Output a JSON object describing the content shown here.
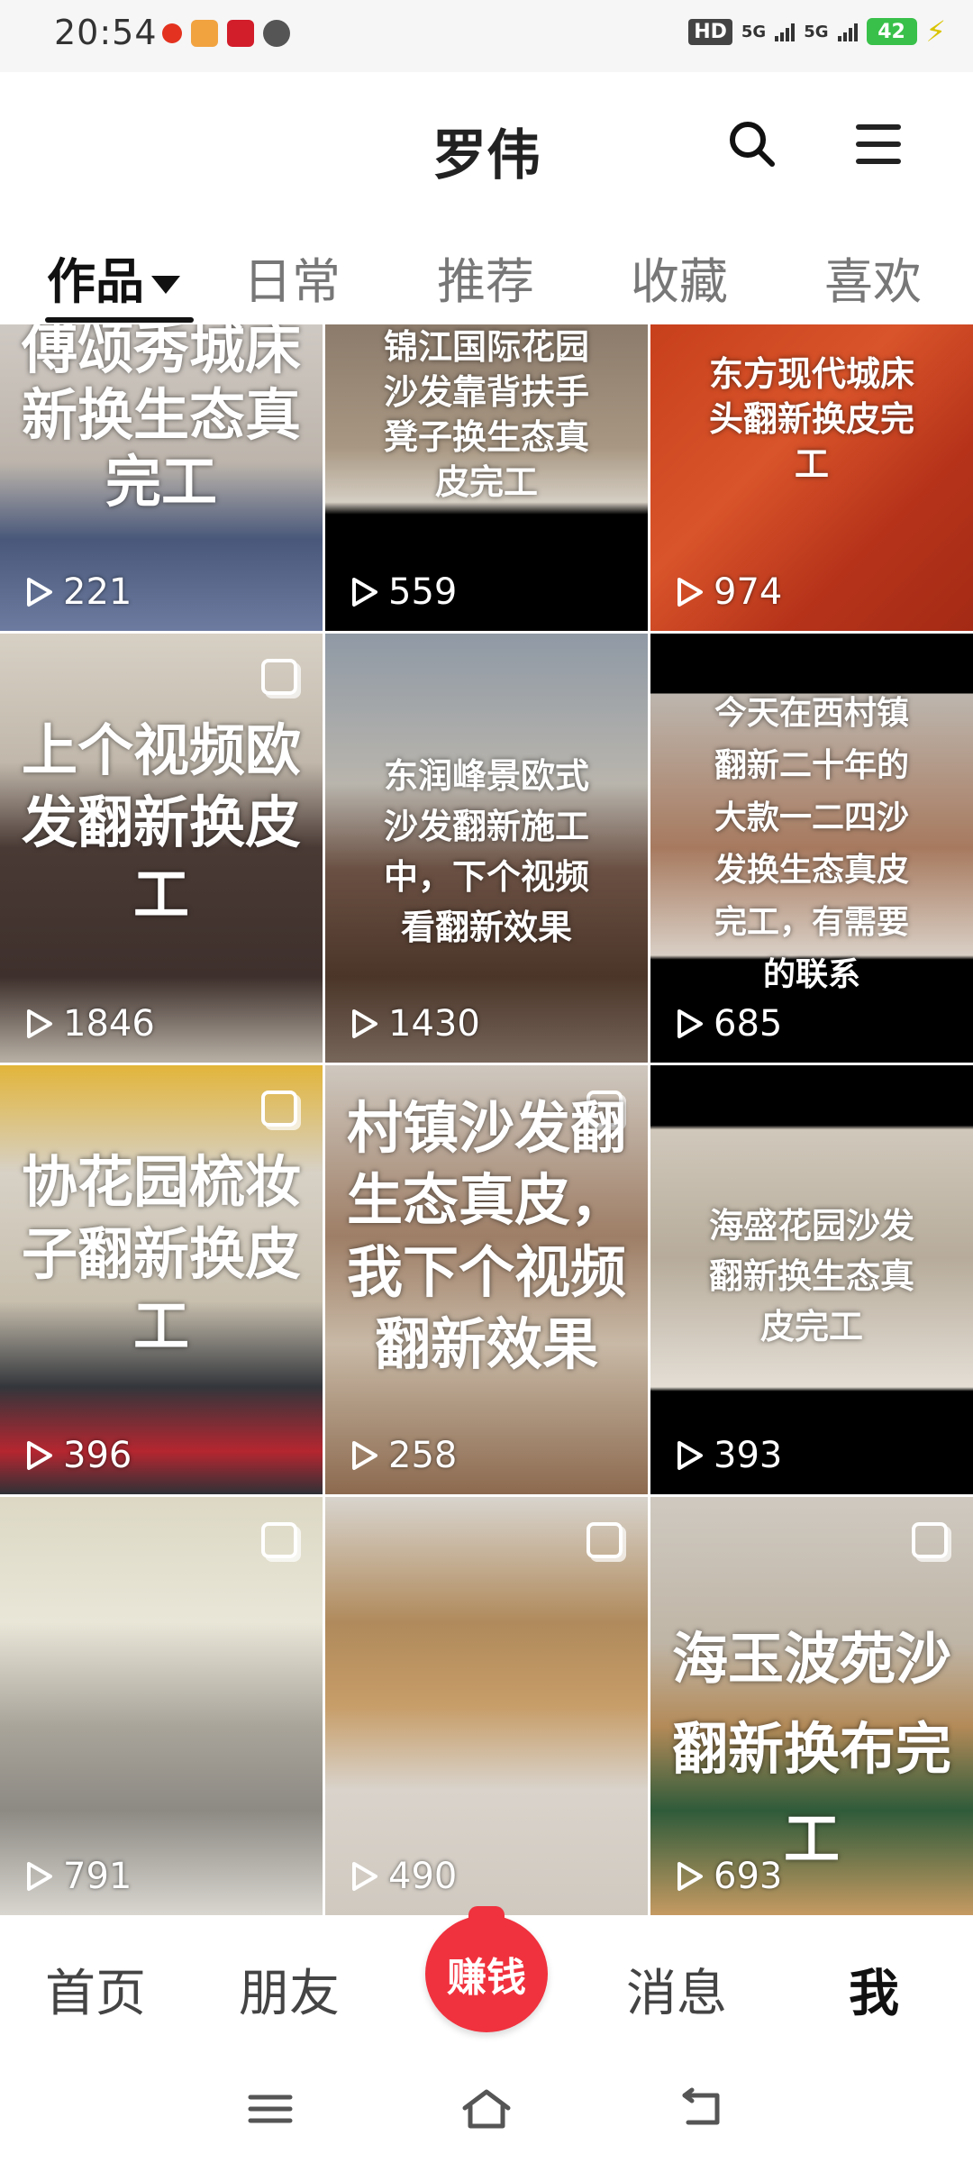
{
  "status_bar": {
    "time": "20:54",
    "network_labels": [
      "HD",
      "5G",
      "5G"
    ],
    "battery": "42"
  },
  "header": {
    "title": "罗伟"
  },
  "tabs": [
    {
      "label": "作品",
      "active": true
    },
    {
      "label": "日常"
    },
    {
      "label": "推荐"
    },
    {
      "label": "收藏"
    },
    {
      "label": "喜欢"
    }
  ],
  "videos": [
    {
      "overlay_lines": [
        "傅颂秀城床",
        "新换生态真",
        "完工"
      ],
      "plays": "221"
    },
    {
      "overlay_lines": [
        "锦江国际花园",
        "沙发靠背扶手",
        "凳子换生态真",
        "皮完工"
      ],
      "plays": "559"
    },
    {
      "overlay_lines": [
        "东方现代城床",
        "头翻新换皮完",
        "工"
      ],
      "plays": "974"
    },
    {
      "overlay_lines": [
        "上个视频欧",
        "发翻新换皮",
        "工"
      ],
      "plays": "1846"
    },
    {
      "overlay_lines": [
        "东润峰景欧式",
        "沙发翻新施工",
        "中，下个视频",
        "看翻新效果"
      ],
      "plays": "1430"
    },
    {
      "overlay_lines": [
        "今天在西村镇",
        "翻新二十年的",
        "大款一二四沙",
        "发换生态真皮",
        "完工，有需要",
        "的联系"
      ],
      "plays": "685"
    },
    {
      "overlay_lines": [
        "协花园梳妆",
        "子翻新换皮",
        "工"
      ],
      "plays": "396"
    },
    {
      "overlay_lines": [
        "村镇沙发翻",
        "生态真皮，",
        "我下个视频",
        "翻新效果"
      ],
      "plays": "258"
    },
    {
      "overlay_lines": [
        "海盛花园沙发",
        "翻新换生态真",
        "皮完工"
      ],
      "plays": "393"
    },
    {
      "overlay_lines": [],
      "plays": "791"
    },
    {
      "overlay_lines": [],
      "plays": "490"
    },
    {
      "overlay_lines": [
        "海玉波苑沙",
        "翻新换布完工"
      ],
      "plays": "693"
    }
  ],
  "bottom_nav": {
    "home": "首页",
    "friends": "朋友",
    "earn": "赚钱",
    "messages": "消息",
    "me": "我"
  }
}
